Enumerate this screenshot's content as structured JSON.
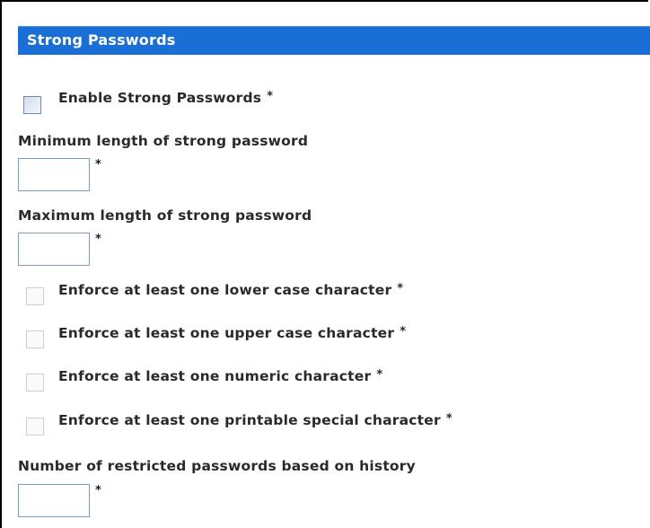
{
  "panel": {
    "title": "Strong Passwords"
  },
  "enable": {
    "label": "Enable Strong Passwords",
    "required_mark": "*",
    "checked": false
  },
  "min_length": {
    "label": "Minimum length of strong password",
    "value": "",
    "required_mark": "*"
  },
  "max_length": {
    "label": "Maximum length of strong password",
    "value": "",
    "required_mark": "*"
  },
  "rules": [
    {
      "label": "Enforce at least one lower case character",
      "required_mark": "*",
      "checked": false
    },
    {
      "label": "Enforce at least one upper case character",
      "required_mark": "*",
      "checked": false
    },
    {
      "label": "Enforce at least one numeric character",
      "required_mark": "*",
      "checked": false
    },
    {
      "label": "Enforce at least one printable special character",
      "required_mark": "*",
      "checked": false
    }
  ],
  "history": {
    "label": "Number of restricted passwords based on history",
    "value": "",
    "required_mark": "*"
  },
  "colors": {
    "header_bg": "#1a6fd6",
    "header_text": "#ffffff",
    "input_border": "#7a9cc8"
  }
}
